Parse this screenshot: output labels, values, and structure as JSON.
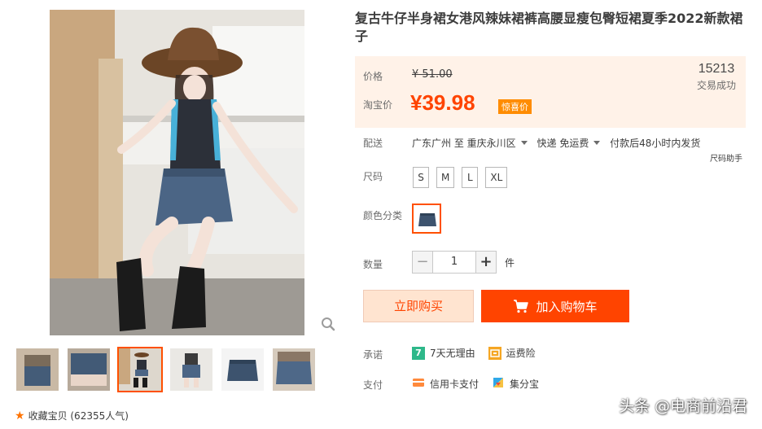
{
  "product": {
    "title": "复古牛仔半身裙女港风辣妹裙裤高腰显瘦包臀短裙夏季2022新款裙子"
  },
  "price": {
    "label": "价格",
    "original": "¥ 51.00",
    "promo_label": "淘宝价",
    "current": "¥39.98",
    "tag": "惊喜价",
    "sold_count": "15213",
    "sold_label": "交易成功"
  },
  "shipping": {
    "label": "配送",
    "from": "广东广州 至",
    "to": "重庆永川区",
    "method": "快递 免运费",
    "dispatch": "付款后48小时内发货",
    "size_helper": "尺码助手"
  },
  "size": {
    "label": "尺码",
    "options": [
      "S",
      "M",
      "L",
      "XL"
    ]
  },
  "color": {
    "label": "颜色分类"
  },
  "quantity": {
    "label": "数量",
    "minus": "−",
    "value": "1",
    "plus": "+",
    "unit": "件"
  },
  "actions": {
    "buy_now": "立即购买",
    "add_to_cart": "加入购物车"
  },
  "promise": {
    "label": "承诺",
    "seven_days_icon": "7",
    "seven_days": "7天无理由",
    "freight_insurance": "运费险"
  },
  "payment": {
    "label": "支付",
    "credit_card": "信用卡支付",
    "jifenbao": "集分宝"
  },
  "favorite": {
    "text": "收藏宝贝 (62355人气)"
  },
  "watermark": "头条 @电商前沿君",
  "colors": {
    "accent": "#ff4400",
    "price_bg": "#fff2e8",
    "tag": "#ff8c00"
  }
}
